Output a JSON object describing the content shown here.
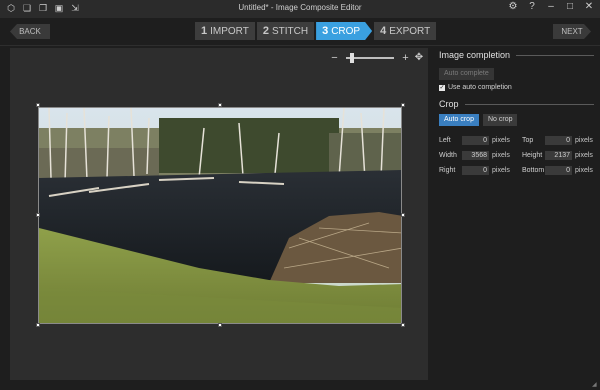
{
  "window": {
    "title": "Untitled* - Image Composite Editor",
    "left_icons": [
      "new-panorama-icon",
      "new-from-video-icon",
      "open-icon",
      "save-icon",
      "export-icon"
    ],
    "right_icons": [
      "settings-icon",
      "help-icon",
      "minimize-icon",
      "maximize-icon",
      "close-icon"
    ]
  },
  "nav": {
    "back_label": "BACK",
    "next_label": "NEXT",
    "steps": [
      {
        "num": "1",
        "label": "IMPORT"
      },
      {
        "num": "2",
        "label": "STITCH"
      },
      {
        "num": "3",
        "label": "CROP"
      },
      {
        "num": "4",
        "label": "EXPORT"
      }
    ],
    "active_step": 3
  },
  "zoom": {
    "minus": "−",
    "plus": "+",
    "level": 0.08
  },
  "panel": {
    "image_completion_title": "Image completion",
    "auto_complete_label": "Auto complete",
    "use_auto_completion_label": "Use auto completion",
    "use_auto_completion_checked": true,
    "crop_title": "Crop",
    "auto_crop_label": "Auto crop",
    "no_crop_label": "No crop",
    "fields": {
      "left": {
        "label": "Left",
        "value": "0",
        "unit": "pixels"
      },
      "top": {
        "label": "Top",
        "value": "0",
        "unit": "pixels"
      },
      "width": {
        "label": "Width",
        "value": "3568",
        "unit": "pixels"
      },
      "height": {
        "label": "Height",
        "value": "2137",
        "unit": "pixels"
      },
      "right": {
        "label": "Right",
        "value": "0",
        "unit": "pixels"
      },
      "bottom": {
        "label": "Bottom",
        "value": "0",
        "unit": "pixels"
      }
    }
  },
  "colors": {
    "accent": "#3aa0e0",
    "primary_button": "#3a7fc0"
  }
}
